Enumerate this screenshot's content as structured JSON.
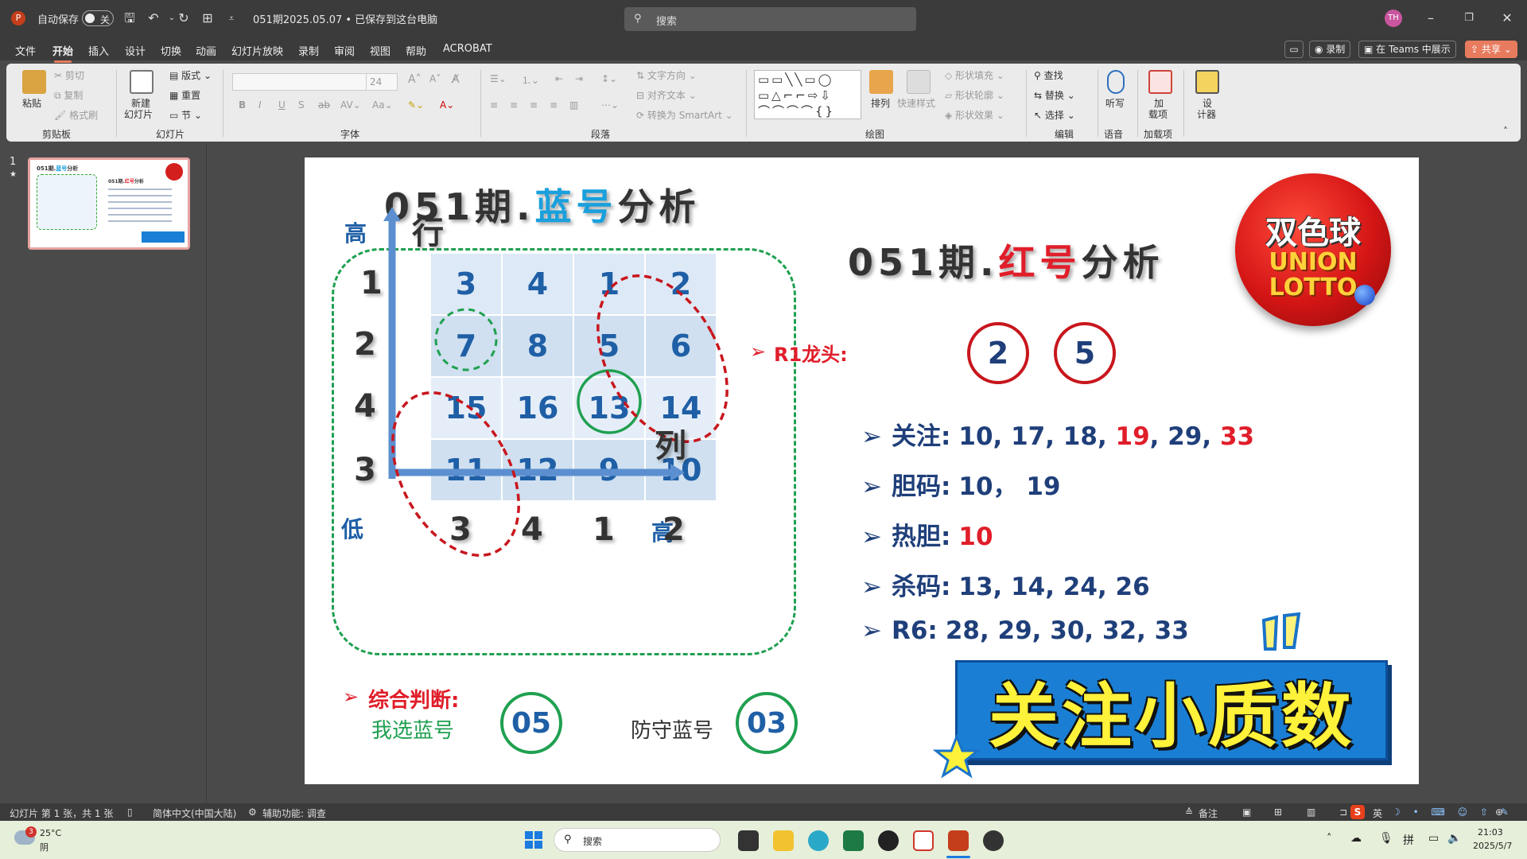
{
  "window": {
    "autosave_label": "自动保存",
    "autosave_state": "关",
    "doc_title": "051期2025.05.07 • 已保存到这台电脑",
    "search_placeholder": "搜索",
    "user_initials": "TH"
  },
  "menu": {
    "tabs": [
      "文件",
      "开始",
      "插入",
      "设计",
      "切换",
      "动画",
      "幻灯片放映",
      "录制",
      "审阅",
      "视图",
      "帮助",
      "ACROBAT"
    ],
    "active_tab": "开始",
    "record_label": "录制",
    "teams_label": "在 Teams 中展示",
    "share_label": "共享"
  },
  "ribbon": {
    "paste": "粘贴",
    "cut": "剪切",
    "copy": "复制",
    "format_painter": "格式刷",
    "clipboard_group": "剪贴板",
    "new_slide_line1": "新建",
    "new_slide_line2": "幻灯片",
    "layout": "版式",
    "reset": "重置",
    "section": "节",
    "slides_group": "幻灯片",
    "font_size": "24",
    "font_group": "字体",
    "text_direction": "文字方向",
    "align_text": "对齐文本",
    "smartart": "转换为 SmartArt",
    "paragraph_group": "段落",
    "arrange": "排列",
    "quick_styles": "快速样式",
    "shape_fill": "形状填充",
    "shape_outline": "形状轮廓",
    "shape_effects": "形状效果",
    "drawing_group": "绘图",
    "find": "查找",
    "replace": "替换",
    "select": "选择",
    "editing_group": "编辑",
    "dictate": "听写",
    "voice_group": "语音",
    "addins_line1": "加",
    "addins_line2": "载项",
    "addins_group": "加载项",
    "designer_line1": "设",
    "designer_line2": "计器"
  },
  "thumbnail": {
    "number": "1",
    "star": "★"
  },
  "slide": {
    "blue_title_prefix": "051期.",
    "blue_title_colored": "蓝号",
    "blue_title_suffix": "分析",
    "red_title_prefix": "051期.",
    "red_title_colored": "红号",
    "red_title_suffix": "分析",
    "logo_line1": "双色球",
    "logo_line2": "UNION",
    "logo_line3": "LOTTO",
    "axis_high_y": "高",
    "axis_row": "行",
    "axis_low": "低",
    "axis_col": "列",
    "axis_high_x": "高",
    "row_labels": [
      "1",
      "2",
      "4",
      "3"
    ],
    "col_labels": [
      "3",
      "4",
      "1",
      "2"
    ],
    "grid": [
      [
        "3",
        "4",
        "1",
        "2"
      ],
      [
        "7",
        "8",
        "5",
        "6"
      ],
      [
        "15",
        "16",
        "13",
        "14"
      ],
      [
        "11",
        "12",
        "9",
        "10"
      ]
    ],
    "r1_label": "R1龙头:",
    "r1_values": [
      "2",
      "5"
    ],
    "focus_label": "关注:",
    "focus_black_1": "10, 17, 18, ",
    "focus_red_1": "19",
    "focus_black_2": ", 29, ",
    "focus_red_2": "33",
    "dan_label": "胆码:",
    "dan_values": "10，  19",
    "hot_label": "热胆:",
    "hot_value": "10",
    "kill_label": "杀码:",
    "kill_values": "13, 14, 24, 26",
    "r6_label": "R6:",
    "r6_values": "28, 29, 30, 32, 33",
    "summary_label": "综合判断:",
    "pick_blue_label": "我选蓝号",
    "pick_blue_value": "05",
    "defend_blue_label": "防守蓝号",
    "defend_blue_value": "03",
    "banner_text": "关注小质数"
  },
  "statusbar": {
    "slide_info": "幻灯片 第 1 张，共 1 张",
    "language": "简体中文(中国大陆)",
    "accessibility": "辅助功能: 调查",
    "notes": "备注",
    "ime": "英"
  },
  "taskbar": {
    "weather_badge": "3",
    "temperature": "25°C",
    "weather_desc": "阴",
    "search_label": "搜索",
    "time": "21:03",
    "date": "2025/5/7"
  },
  "colors": {
    "accent_blue": "#1aa0dc",
    "accent_red": "#e01e2a",
    "dark_blue_text": "#1f3f7a",
    "green_circle": "#1fa050"
  }
}
